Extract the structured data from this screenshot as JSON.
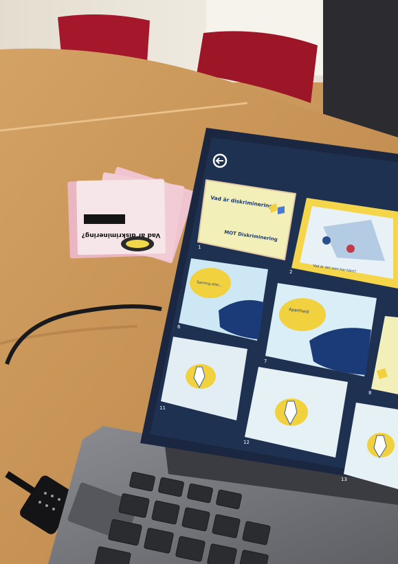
{
  "screen": {
    "back_icon": "back-arrow-icon",
    "slides": [
      {
        "number": "1",
        "title": "Vad är diskriminering?",
        "logo": "MOT Diskriminering",
        "bg": "#f3efb8"
      },
      {
        "number": "2",
        "title": "Vad är det som har hänt?",
        "bg": "#f5d64a"
      },
      {
        "number": "6",
        "title": "Sanning eller...",
        "bg": "#cde8f4"
      },
      {
        "number": "7",
        "title": "Apartheid",
        "bg": "#d9eef6"
      },
      {
        "number": "8",
        "title": "",
        "bg": "#f3efb8"
      },
      {
        "number": "11",
        "title": "",
        "bg": "#e2eef3"
      },
      {
        "number": "12",
        "title": "",
        "bg": "#e6f1f5"
      },
      {
        "number": "13",
        "title": "",
        "bg": "#e6f1f5"
      }
    ]
  },
  "brochure": {
    "title": "Vad är diskriminering?",
    "logo": "MOT Diskriminering"
  },
  "colors": {
    "table": "#c9985a",
    "chair": "#a5172b",
    "laptop_body": "#76787d",
    "bezel": "#1b2740",
    "screen_bg": "#1f3151",
    "accent_yellow": "#f1d13e",
    "accent_navy": "#1a3b78",
    "brochure_pink": "#e9b6c2"
  }
}
